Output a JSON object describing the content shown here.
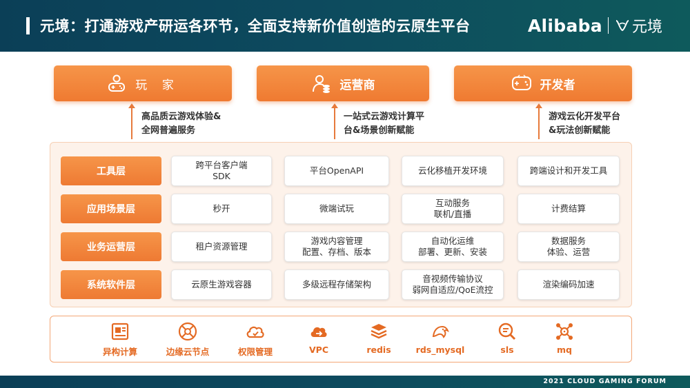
{
  "header": {
    "title": "元境：打通游戏产研运各环节，全面支持新价值创造的云原生平台",
    "brand": "Alibaba",
    "brand_cn": "元境"
  },
  "roles": [
    {
      "label": "玩 家",
      "icon": "gamer-icon"
    },
    {
      "label": "运营商",
      "icon": "operator-icon"
    },
    {
      "label": "开发者",
      "icon": "developer-icon"
    }
  ],
  "captions": [
    {
      "line1": "高品质云游戏体验&",
      "line2": "全网普遍服务"
    },
    {
      "line1": "一站式云游戏计算平",
      "line2": "台&场景创新赋能"
    },
    {
      "line1": "游戏云化开发平台",
      "line2": "&玩法创新赋能"
    }
  ],
  "layers": [
    {
      "label": "工具层",
      "cells": [
        {
          "l1": "跨平台客户端",
          "l2": "SDK"
        },
        {
          "l1": "平台OpenAPI",
          "l2": ""
        },
        {
          "l1": "云化移植开发环境",
          "l2": ""
        },
        {
          "l1": "跨端设计和开发工具",
          "l2": ""
        }
      ]
    },
    {
      "label": "应用场景层",
      "cells": [
        {
          "l1": "秒开",
          "l2": ""
        },
        {
          "l1": "微端试玩",
          "l2": ""
        },
        {
          "l1": "互动服务",
          "l2": "联机/直播"
        },
        {
          "l1": "计费结算",
          "l2": ""
        }
      ]
    },
    {
      "label": "业务运营层",
      "cells": [
        {
          "l1": "租户资源管理",
          "l2": ""
        },
        {
          "l1": "游戏内容管理",
          "l2": "配置、存档、版本"
        },
        {
          "l1": "自动化运维",
          "l2": "部署、更新、安装"
        },
        {
          "l1": "数据服务",
          "l2": "体验、运营"
        }
      ]
    },
    {
      "label": "系统软件层",
      "cells": [
        {
          "l1": "云原生游戏容器",
          "l2": ""
        },
        {
          "l1": "多级远程存储架构",
          "l2": ""
        },
        {
          "l1": "音视频传输协议",
          "l2": "弱网自适应/QoE流控"
        },
        {
          "l1": "渲染编码加速",
          "l2": ""
        }
      ]
    }
  ],
  "services": [
    {
      "label": "异构计算",
      "icon": "gpu-card-icon"
    },
    {
      "label": "边缘云节点",
      "icon": "edge-node-icon"
    },
    {
      "label": "权限管理",
      "icon": "cloud-permission-icon"
    },
    {
      "label": "VPC",
      "icon": "vpc-cloud-icon"
    },
    {
      "label": "redis",
      "icon": "redis-icon"
    },
    {
      "label": "rds_mysql",
      "icon": "mysql-dolphin-icon"
    },
    {
      "label": "sls",
      "icon": "sls-search-icon"
    },
    {
      "label": "mq",
      "icon": "mq-network-icon"
    }
  ],
  "footer": "2021 CLOUD GAMING FORUM",
  "colors": {
    "accent": "#ef7a31",
    "header_bg": "#0b3f57",
    "panel_bg": "#fdf2ea"
  }
}
